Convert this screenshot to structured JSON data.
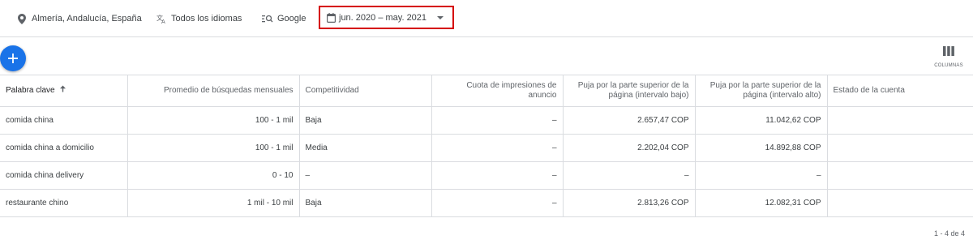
{
  "filters": {
    "location": "Almería, Andalucía, España",
    "language": "Todos los idiomas",
    "network": "Google",
    "date_range": "jun. 2020 – may. 2021"
  },
  "toolbar": {
    "columns_label": "COLUMNAS"
  },
  "table": {
    "headers": {
      "keyword": "Palabra clave",
      "avg_searches": "Promedio de búsquedas mensuales",
      "competition": "Competitividad",
      "impression_share": "Cuota de impresiones de anuncio",
      "bid_low": "Puja por la parte superior de la página (intervalo bajo)",
      "bid_high": "Puja por la parte superior de la página (intervalo alto)",
      "account_status": "Estado de la cuenta"
    },
    "rows": [
      {
        "keyword": "comida china",
        "avg_searches": "100 - 1 mil",
        "competition": "Baja",
        "impression_share": "–",
        "bid_low": "2.657,47 COP",
        "bid_high": "11.042,62 COP",
        "account_status": ""
      },
      {
        "keyword": "comida china a domicilio",
        "avg_searches": "100 - 1 mil",
        "competition": "Media",
        "impression_share": "–",
        "bid_low": "2.202,04 COP",
        "bid_high": "14.892,88 COP",
        "account_status": ""
      },
      {
        "keyword": "comida china delivery",
        "avg_searches": "0 - 10",
        "competition": "–",
        "impression_share": "–",
        "bid_low": "–",
        "bid_high": "–",
        "account_status": ""
      },
      {
        "keyword": "restaurante chino",
        "avg_searches": "1 mil - 10 mil",
        "competition": "Baja",
        "impression_share": "–",
        "bid_low": "2.813,26 COP",
        "bid_high": "12.082,31 COP",
        "account_status": ""
      }
    ]
  },
  "pagination": "1 - 4 de 4",
  "colors": {
    "accent": "#1a73e8",
    "highlight_border": "#d50000"
  }
}
